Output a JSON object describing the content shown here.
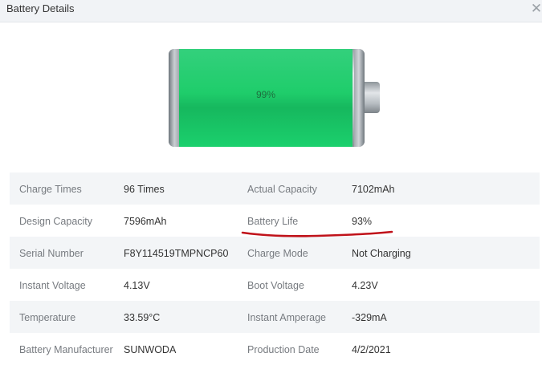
{
  "window": {
    "title": "Battery Details",
    "close_label": "✕"
  },
  "battery": {
    "percent_label": "99%",
    "level": 0.99,
    "fill_color": "#1fcd6b"
  },
  "details": [
    {
      "label1": "Charge Times",
      "value1": "96 Times",
      "label2": "Actual Capacity",
      "value2": "7102mAh"
    },
    {
      "label1": "Design Capacity",
      "value1": "7596mAh",
      "label2": "Battery Life",
      "value2": "93%"
    },
    {
      "label1": "Serial Number",
      "value1": "F8Y114519TMPNCP60",
      "label2": "Charge Mode",
      "value2": "Not Charging"
    },
    {
      "label1": "Instant Voltage",
      "value1": "4.13V",
      "label2": "Boot Voltage",
      "value2": "4.23V"
    },
    {
      "label1": "Temperature",
      "value1": "33.59°C",
      "label2": "Instant Amperage",
      "value2": "-329mA"
    },
    {
      "label1": "Battery Manufacturer",
      "value1": "SUNWODA",
      "label2": "Production Date",
      "value2": "4/2/2021"
    }
  ],
  "annotation": {
    "underline_color": "#c0121a"
  }
}
